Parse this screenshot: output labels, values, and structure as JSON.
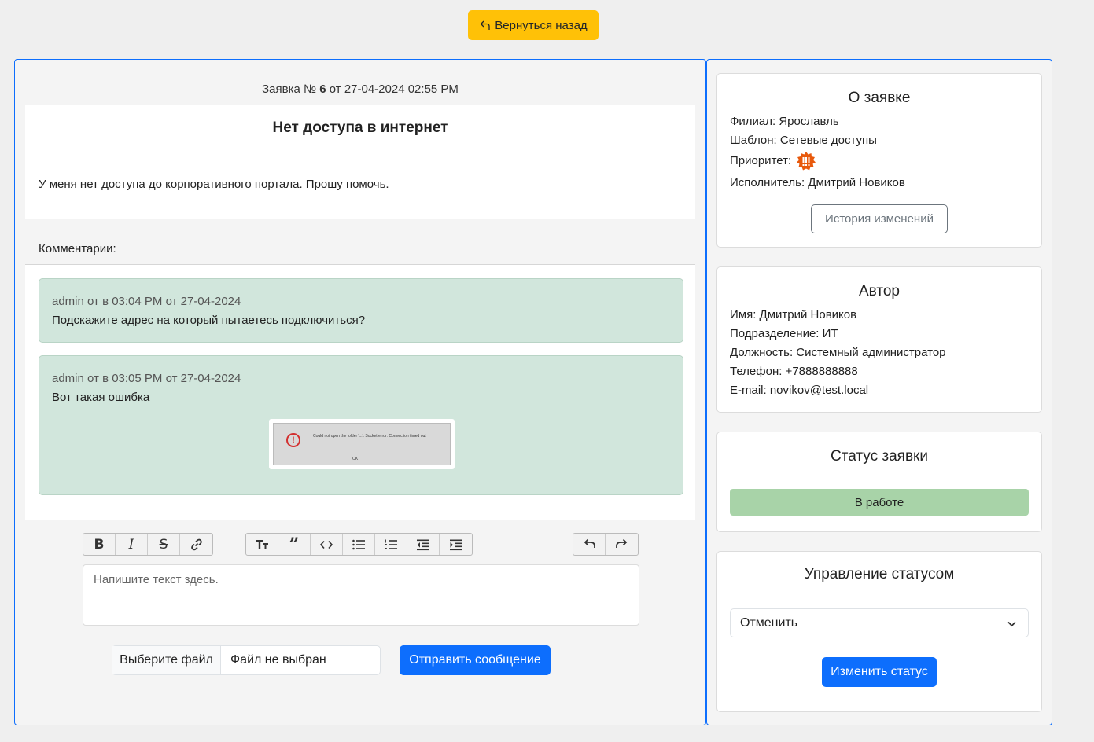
{
  "nav": {
    "back_label": "Вернуться назад"
  },
  "ticket": {
    "header_prefix": "Заявка №",
    "number": "6",
    "header_suffix": "от 27-04-2024 02:55 PM",
    "title": "Нет доступа в интернет",
    "description": "У меня нет доступа до корпоративного портала. Прошу помочь."
  },
  "comments": {
    "label": "Комментарии:",
    "items": [
      {
        "meta": "admin от в 03:04 PM от 27-04-2024",
        "text": "Подскажите адрес на который пытаетесь подключиться?"
      },
      {
        "meta": "admin от в 03:05 PM от 27-04-2024",
        "text": "Вот такая ошибка",
        "attachment": {
          "message": "Could not open the folder '...': Socket error: Connection timed out",
          "button": "OK"
        }
      }
    ]
  },
  "editor": {
    "toolbar_groups": [
      [
        "bold-icon",
        "italic-icon",
        "strikethrough-icon",
        "link-icon"
      ],
      [
        "heading-icon",
        "quote-icon",
        "code-icon",
        "bullet-list-icon",
        "numbered-list-icon",
        "outdent-icon",
        "indent-icon"
      ],
      [
        "undo-icon",
        "redo-icon"
      ]
    ],
    "placeholder": "Напишите текст здесь.",
    "file_button": "Выберите файл",
    "file_status": "Файл не выбран",
    "send_label": "Отправить сообщение"
  },
  "about": {
    "title": "О заявке",
    "branch": "Филиал: Ярославль",
    "template": "Шаблон: Сетевые доступы",
    "priority_label": "Приоритет:",
    "priority_badge": "!!!",
    "priority_color": "#e8590c",
    "assignee": "Исполнитель: Дмитрий Новиков",
    "history_label": "История изменений"
  },
  "author": {
    "title": "Автор",
    "name": "Имя: Дмитрий Новиков",
    "department": "Подразделение: ИТ",
    "position": "Должность: Системный администратор",
    "phone": "Телефон: +7888888888",
    "email": "E-mail: novikov@test.local"
  },
  "status": {
    "title": "Статус заявки",
    "value": "В работе",
    "color": "#a8d3a8"
  },
  "manage": {
    "title": "Управление статусом",
    "selected": "Отменить",
    "submit_label": "Изменить статус"
  },
  "colors": {
    "primary": "#0d6efd",
    "warning": "#ffc107",
    "comment_bg": "#d1e6dc"
  }
}
